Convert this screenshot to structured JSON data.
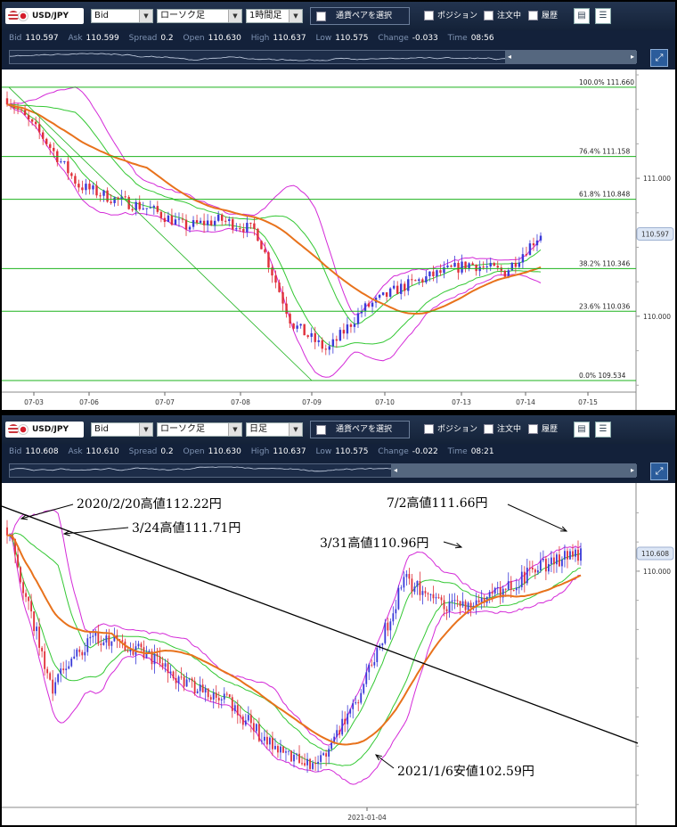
{
  "panels": [
    {
      "toolbar": {
        "pair": "USD/JPY",
        "price_type": "Bid",
        "chart_type": "ローソク足",
        "timeframe": "1時間足",
        "pair_select": "通貨ペアを選択",
        "position": "ポジション",
        "orders": "注文中",
        "history": "履歴"
      },
      "quote": {
        "bid_label": "Bid",
        "bid": "110.597",
        "ask_label": "Ask",
        "ask": "110.599",
        "spread_label": "Spread",
        "spread": "0.2",
        "open_label": "Open",
        "open": "110.630",
        "high_label": "High",
        "high": "110.637",
        "low_label": "Low",
        "low": "110.575",
        "change_label": "Change",
        "change": "-0.033",
        "time_label": "Time",
        "time": "08:56"
      },
      "price_tag": "110.597"
    },
    {
      "toolbar": {
        "pair": "USD/JPY",
        "price_type": "Bid",
        "chart_type": "ローソク足",
        "timeframe": "日足",
        "pair_select": "通貨ペアを選択",
        "position": "ポジション",
        "orders": "注文中",
        "history": "履歴"
      },
      "quote": {
        "bid_label": "Bid",
        "bid": "110.608",
        "ask_label": "Ask",
        "ask": "110.610",
        "spread_label": "Spread",
        "spread": "0.2",
        "open_label": "Open",
        "open": "110.630",
        "high_label": "High",
        "high": "110.637",
        "low_label": "Low",
        "low": "110.575",
        "change_label": "Change",
        "change": "-0.022",
        "time_label": "Time",
        "time": "08:21"
      },
      "price_tag": "110.608"
    }
  ],
  "colors": {
    "candle_up": "#3a3ad8",
    "candle_down": "#e0303a",
    "bollinger": "#d42ad8",
    "inner_band": "#34c834",
    "moving_average": "#e8721c",
    "fib_line": "#1db31d",
    "trendline": "#000000"
  },
  "chart_data": [
    {
      "type": "candlestick",
      "timeframe": "1時間足",
      "x_ticks": [
        "07-03",
        "07-06",
        "07-07",
        "07-08",
        "07-09",
        "07-10",
        "07-13",
        "07-14",
        "07-15"
      ],
      "y_ticks": [
        "111.000",
        "110.000"
      ],
      "ylim": [
        109.45,
        111.75
      ],
      "current_price": 110.597,
      "fibonacci": [
        {
          "label": "100.0%",
          "price": "111.660",
          "value": 111.66
        },
        {
          "label": "76.4%",
          "price": "111.158",
          "value": 111.158
        },
        {
          "label": "61.8%",
          "price": "110.848",
          "value": 110.848
        },
        {
          "label": "38.2%",
          "price": "110.346",
          "value": 110.346
        },
        {
          "label": "23.6%",
          "price": "110.036",
          "value": 110.036
        },
        {
          "label": "0.0%",
          "price": "109.534",
          "value": 109.534
        }
      ],
      "approx_close_path": [
        [
          "07-03",
          111.58
        ],
        [
          "07-03",
          111.3
        ],
        [
          "07-06",
          110.95
        ],
        [
          "07-06",
          110.85
        ],
        [
          "07-07",
          110.78
        ],
        [
          "07-07",
          110.65
        ],
        [
          "07-08",
          110.7
        ],
        [
          "07-08",
          110.62
        ],
        [
          "07-09",
          109.95
        ],
        [
          "07-09",
          109.75
        ],
        [
          "07-10",
          110.05
        ],
        [
          "07-10",
          110.2
        ],
        [
          "07-13",
          110.3
        ],
        [
          "07-13",
          110.38
        ],
        [
          "07-14",
          110.32
        ],
        [
          "07-14",
          110.6
        ]
      ]
    },
    {
      "type": "candlestick",
      "timeframe": "日足",
      "x_ticks": [
        "2021-01-04"
      ],
      "y_ticks": [
        "110.000"
      ],
      "ylim": [
        101.9,
        112.9
      ],
      "current_price": 110.608,
      "annotations": [
        {
          "text": "2020/2/20高値112.22円",
          "value": 112.22
        },
        {
          "text": "3/24高値111.71円",
          "value": 111.71
        },
        {
          "text": "3/31高値110.96円",
          "value": 110.96
        },
        {
          "text": "7/2高値111.66円",
          "value": 111.66
        },
        {
          "text": "2021/1/6安値102.59円",
          "value": 102.59
        }
      ],
      "approx_close_path": [
        [
          "2020-02",
          111.5
        ],
        [
          "2020-03",
          106.0
        ],
        [
          "2020-04",
          107.8
        ],
        [
          "2020-06",
          107.3
        ],
        [
          "2020-08",
          106.2
        ],
        [
          "2020-10",
          105.5
        ],
        [
          "2020-12",
          104.0
        ],
        [
          "2021-01-04",
          103.2
        ],
        [
          "2021-02",
          105.8
        ],
        [
          "2021-03",
          109.7
        ],
        [
          "2021-04",
          108.8
        ],
        [
          "2021-05",
          109.1
        ],
        [
          "2021-06",
          110.1
        ],
        [
          "2021-07",
          110.6
        ]
      ]
    }
  ]
}
